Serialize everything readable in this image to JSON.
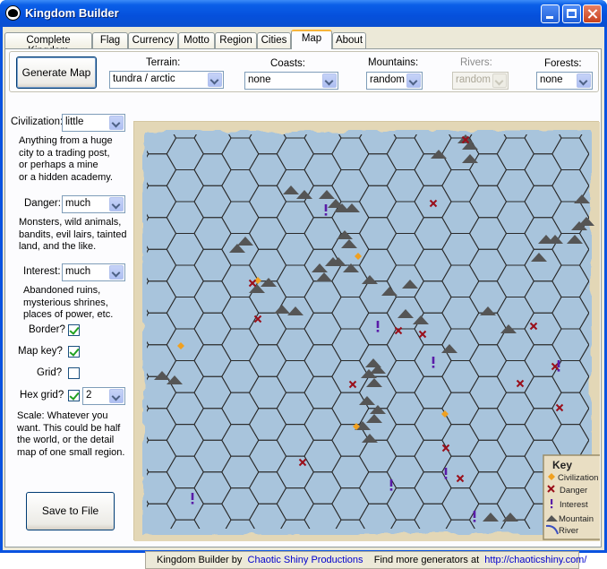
{
  "window": {
    "title": "Kingdom Builder"
  },
  "tabs": [
    "Complete Kingdom",
    "Flag",
    "Currency",
    "Motto",
    "Region",
    "Cities",
    "Map",
    "About"
  ],
  "active_tab": "Map",
  "toolbar": {
    "generate_label": "Generate Map",
    "terrain": {
      "label": "Terrain:",
      "value": "tundra / arctic"
    },
    "coasts": {
      "label": "Coasts:",
      "value": "none"
    },
    "mountains": {
      "label": "Mountains:",
      "value": "random"
    },
    "rivers": {
      "label": "Rivers:",
      "value": "random",
      "disabled": true
    },
    "forests": {
      "label": "Forests:",
      "value": "none"
    }
  },
  "options": {
    "civilization": {
      "label": "Civilization:",
      "value": "little",
      "description": "Anything from a huge\ncity to a trading post,\nor perhaps a mine\nor a hidden academy."
    },
    "danger": {
      "label": "Danger:",
      "value": "much",
      "description": "Monsters, wild animals,\nbandits, evil lairs, tainted\nland, and the like."
    },
    "interest": {
      "label": "Interest:",
      "value": "much",
      "description": "Abandoned ruins,\nmysterious shrines,\nplaces of power, etc."
    },
    "border": {
      "label": "Border?",
      "checked": true
    },
    "map_key": {
      "label": "Map key?",
      "checked": true
    },
    "grid": {
      "label": "Grid?",
      "checked": false
    },
    "hex_grid": {
      "label": "Hex grid?",
      "checked": true,
      "value": "2"
    },
    "scale_text": "Scale: Whatever you\nwant. This could be half\nthe world, or the detail\nmap of one small region.",
    "save_label": "Save to File"
  },
  "map_key": {
    "title": "Key",
    "items": [
      {
        "label": "Civilization",
        "icon": "diamond-icon",
        "color": "#f0a020"
      },
      {
        "label": "Danger",
        "icon": "cross-icon",
        "color": "#9a0f1a"
      },
      {
        "label": "Interest",
        "icon": "exclamation-icon",
        "color": "#5a1ca8"
      },
      {
        "label": "Mountain",
        "icon": "mountain-icon",
        "color": "#555555"
      },
      {
        "label": "River",
        "icon": "river-icon",
        "color": "#3a4fc0"
      }
    ]
  },
  "statusbar": {
    "prefix": "Kingdom Builder by",
    "author": "Chaotic Shiny Productions",
    "middle": "Find more generators at",
    "url": "http://chaoticshiny.com/"
  },
  "colors": {
    "map_water": "#a8c4dc",
    "civilization": "#f0a020",
    "danger": "#9a0f1a",
    "interest": "#5a1ca8",
    "mountain": "#555555"
  }
}
